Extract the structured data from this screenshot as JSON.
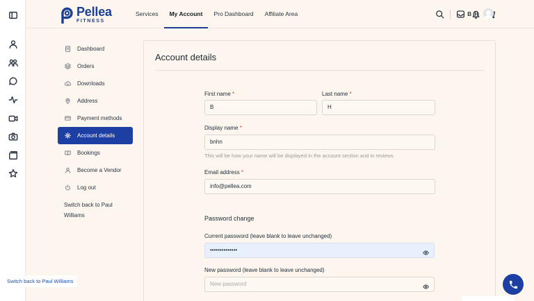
{
  "brand": {
    "name": "Pellea",
    "tagline": "FITNESS",
    "color": "#1b3f94"
  },
  "nav": {
    "items": [
      "Services",
      "My Account",
      "Pro Dashboard",
      "Affiliate Area"
    ],
    "active": "My Account"
  },
  "user": {
    "initials": "B H"
  },
  "rail_icons": [
    "sidebar-toggle-icon",
    "users-icon",
    "groups-icon",
    "chat-icon",
    "activity-icon",
    "video-icon",
    "camera-icon",
    "folders-icon",
    "star-icon"
  ],
  "header_icons": [
    "search-icon",
    "inbox-icon",
    "bell-icon",
    "cart-icon"
  ],
  "account_menu": {
    "items": [
      {
        "label": "Dashboard",
        "icon": "dashboard-icon"
      },
      {
        "label": "Orders",
        "icon": "orders-icon"
      },
      {
        "label": "Downloads",
        "icon": "downloads-icon"
      },
      {
        "label": "Address",
        "icon": "address-icon"
      },
      {
        "label": "Payment methods",
        "icon": "payment-icon"
      },
      {
        "label": "Account details",
        "icon": "gear-icon"
      },
      {
        "label": "Bookings",
        "icon": "bookings-icon"
      },
      {
        "label": "Become a Vendor",
        "icon": "vendor-icon"
      },
      {
        "label": "Log out",
        "icon": "logout-icon"
      }
    ],
    "active": "Account details",
    "switch_back": "Switch back to Paul Williams"
  },
  "form": {
    "title": "Account details",
    "first_name": {
      "label": "First name",
      "value": "B"
    },
    "last_name": {
      "label": "Last name",
      "value": "H"
    },
    "display_name": {
      "label": "Display name",
      "value": "bnhn",
      "hint": "This will be how your name will be displayed in the account section and in reviews"
    },
    "email": {
      "label": "Email address",
      "value": "info@pellea.com"
    },
    "password_section": "Password change",
    "current_password": {
      "label": "Current password (leave blank to leave unchanged)",
      "value": "••••••••••••••"
    },
    "new_password": {
      "label": "New password (leave blank to leave unchanged)",
      "placeholder": "New password"
    },
    "required_mark": "*"
  },
  "tooltip": "Switch back to Paul Williams"
}
